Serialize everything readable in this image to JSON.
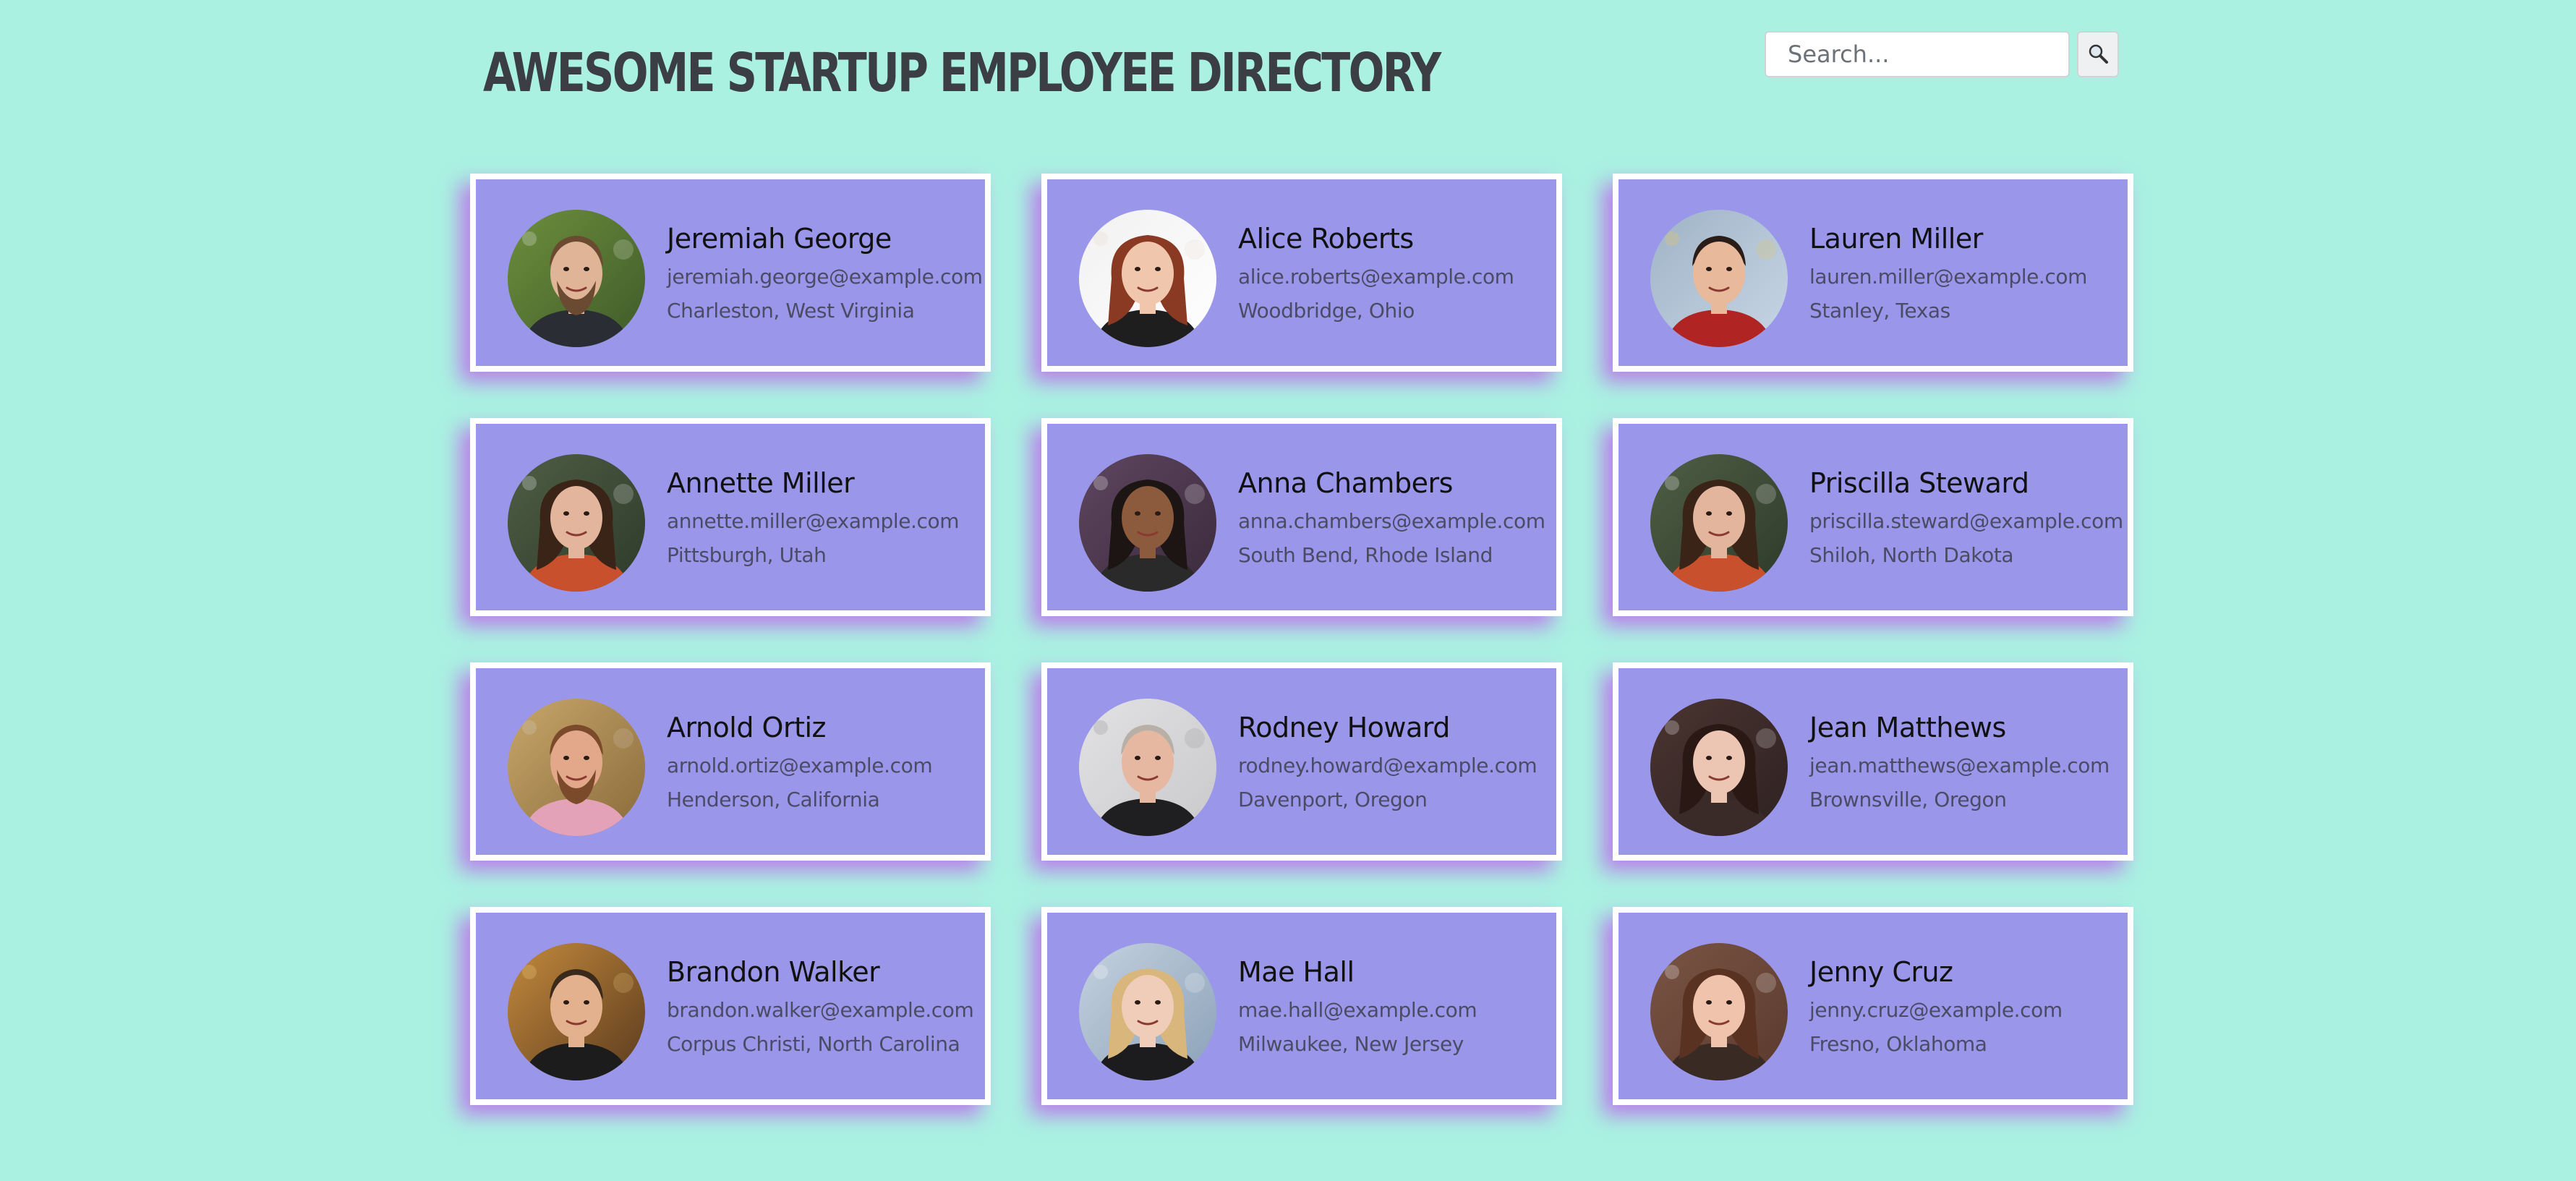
{
  "header": {
    "title": "Awesome Startup Employee Directory",
    "search_placeholder": "Search...",
    "search_value": ""
  },
  "colors": {
    "background": "#aaf1e2",
    "card": "#9a97ea",
    "card_border": "#ffffff",
    "card_shadow": "#be5aeb",
    "title": "#3b3f44"
  },
  "employees": [
    {
      "name": "Jeremiah George",
      "email": "jeremiah.george@example.com",
      "location": "Charleston, West Virginia",
      "avatar": "man-beard-suit"
    },
    {
      "name": "Alice Roberts",
      "email": "alice.roberts@example.com",
      "location": "Woodbridge, Ohio",
      "avatar": "woman-smiling-red-hair"
    },
    {
      "name": "Lauren Miller",
      "email": "lauren.miller@example.com",
      "location": "Stanley, Texas",
      "avatar": "woman-outdoor-red-shirt"
    },
    {
      "name": "Annette Miller",
      "email": "annette.miller@example.com",
      "location": "Pittsburgh, Utah",
      "avatar": "woman-long-curly-hair"
    },
    {
      "name": "Anna Chambers",
      "email": "anna.chambers@example.com",
      "location": "South Bend, Rhode Island",
      "avatar": "woman-curly-hair-smiling"
    },
    {
      "name": "Priscilla Steward",
      "email": "priscilla.steward@example.com",
      "location": "Shiloh, North Dakota",
      "avatar": "woman-long-curly-hair"
    },
    {
      "name": "Arnold Ortiz",
      "email": "arnold.ortiz@example.com",
      "location": "Henderson, California",
      "avatar": "man-bald-beard"
    },
    {
      "name": "Rodney Howard",
      "email": "rodney.howard@example.com",
      "location": "Davenport, Oregon",
      "avatar": "man-bald-glasses"
    },
    {
      "name": "Jean Matthews",
      "email": "jean.matthews@example.com",
      "location": "Brownsville, Oregon",
      "avatar": "woman-selfie-dark"
    },
    {
      "name": "Brandon Walker",
      "email": "brandon.walker@example.com",
      "location": "Corpus Christi, North Carolina",
      "avatar": "man-smiling-lights"
    },
    {
      "name": "Mae Hall",
      "email": "mae.hall@example.com",
      "location": "Milwaukee, New Jersey",
      "avatar": "woman-blonde-waterfront"
    },
    {
      "name": "Jenny Cruz",
      "email": "jenny.cruz@example.com",
      "location": "Fresno, Oklahoma",
      "avatar": "woman-brown-hair-excited"
    }
  ]
}
